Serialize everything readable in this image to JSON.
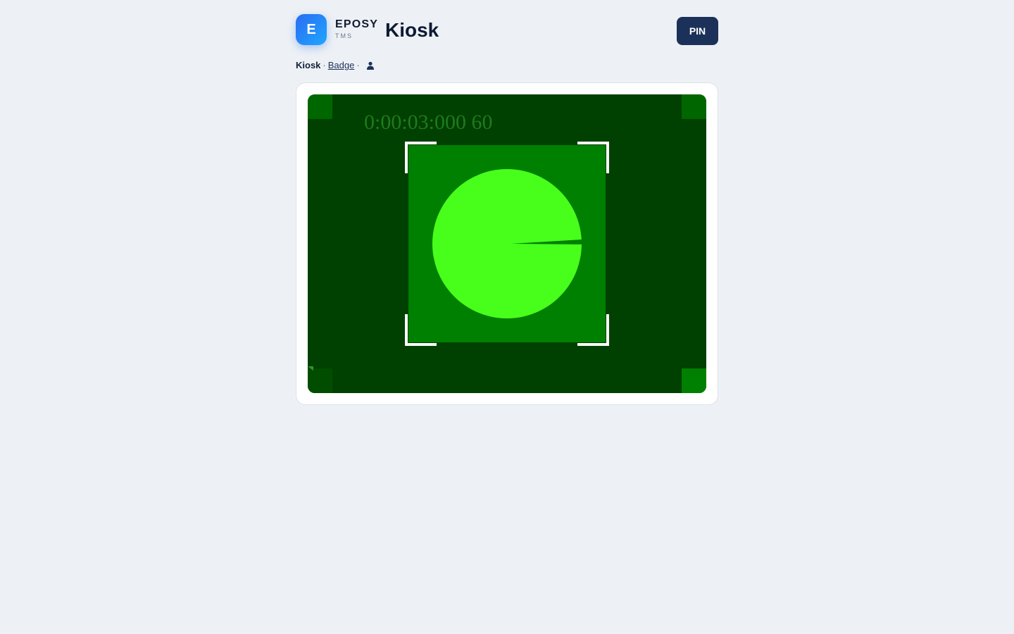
{
  "app": {
    "logo_letter": "E",
    "brand_name": "EPOSY",
    "brand_sub": "TMS",
    "page_title": "Kiosk"
  },
  "header": {
    "pin_label": "PIN"
  },
  "breadcrumb": {
    "current": "Kiosk",
    "separator": "·",
    "badge_link": "Badge",
    "user_icon": "user-icon"
  },
  "camera": {
    "timecode": "0:00:03:000 60",
    "background_color": "#004000",
    "square_color": "#008000",
    "circle_color": "#48ff1c",
    "wedge_color": "#008000",
    "frame_color": "#ffffff"
  }
}
